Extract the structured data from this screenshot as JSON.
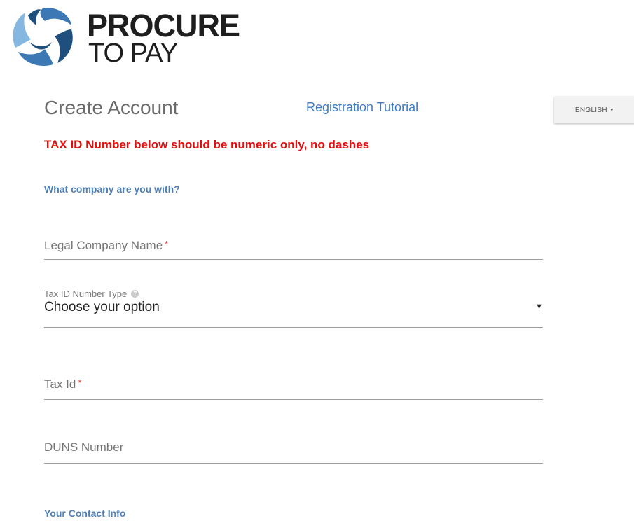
{
  "brand": {
    "name_line1": "PROCURE",
    "name_line2": "TO PAY",
    "colors": {
      "mark_dark": "#1f4f7d",
      "mark_mid": "#3b78b4",
      "mark_light": "#86b7e0"
    }
  },
  "header": {
    "title": "Create Account",
    "tutorial_link": "Registration Tutorial",
    "language": "ENGLISH"
  },
  "warning": "TAX ID Number below should be numeric only, no dashes",
  "sections": {
    "company": "What company are you with?",
    "contact": "Your Contact Info"
  },
  "fields": {
    "legal_name": {
      "label": "Legal Company Name",
      "required_mark": "*"
    },
    "tax_type": {
      "label": "Tax ID Number Type",
      "help_icon": "?",
      "value": "Choose your option",
      "caret": "▼"
    },
    "tax_id": {
      "label": "Tax Id",
      "required_mark": "*"
    },
    "duns": {
      "label": "DUNS Number"
    }
  },
  "colors": {
    "link": "#3d7bc7",
    "warning": "#e30f0f",
    "section": "#4f7fb4",
    "required": "#e53935"
  }
}
